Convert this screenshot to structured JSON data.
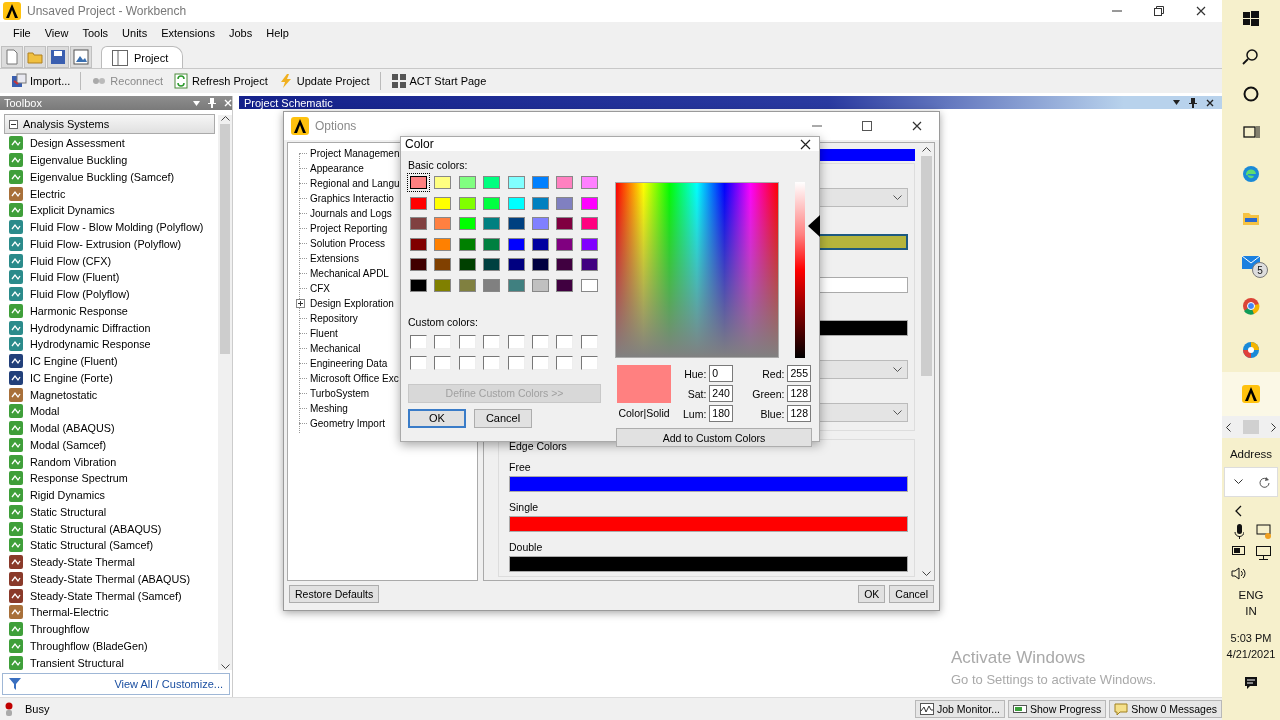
{
  "window": {
    "title": "Unsaved Project - Workbench"
  },
  "menu": [
    "File",
    "View",
    "Tools",
    "Units",
    "Extensions",
    "Jobs",
    "Help"
  ],
  "tabs": [
    {
      "label": "Project",
      "selected": true
    }
  ],
  "toolbar": [
    {
      "kind": "import",
      "label": "Import...",
      "disabled": false
    },
    {
      "kind": "reconnect",
      "label": "Reconnect",
      "disabled": true
    },
    {
      "kind": "refresh",
      "label": "Refresh Project",
      "disabled": false
    },
    {
      "kind": "update",
      "label": "Update Project",
      "disabled": false
    },
    {
      "kind": "act",
      "label": "ACT Start Page",
      "disabled": false
    }
  ],
  "toolbox": {
    "title": "Toolbox",
    "group": {
      "label": "Analysis Systems",
      "expanded": true
    },
    "items": [
      {
        "label": "Design Assessment",
        "color": "#3f9f3a"
      },
      {
        "label": "Eigenvalue Buckling",
        "color": "#3f9f3a"
      },
      {
        "label": "Eigenvalue Buckling (Samcef)",
        "color": "#3f9f3a"
      },
      {
        "label": "Electric",
        "color": "#a8703a"
      },
      {
        "label": "Explicit Dynamics",
        "color": "#3f9f3a"
      },
      {
        "label": "Fluid Flow - Blow Molding (Polyflow)",
        "color": "#2b8b8b"
      },
      {
        "label": "Fluid Flow- Extrusion (Polyflow)",
        "color": "#2b8b8b"
      },
      {
        "label": "Fluid Flow (CFX)",
        "color": "#2b8b8b"
      },
      {
        "label": "Fluid Flow (Fluent)",
        "color": "#2b8b8b"
      },
      {
        "label": "Fluid Flow (Polyflow)",
        "color": "#2b8b8b"
      },
      {
        "label": "Harmonic Response",
        "color": "#3f9f3a"
      },
      {
        "label": "Hydrodynamic Diffraction",
        "color": "#2b8b8b"
      },
      {
        "label": "Hydrodynamic Response",
        "color": "#2b8b8b"
      },
      {
        "label": "IC Engine (Fluent)",
        "color": "#22407a"
      },
      {
        "label": "IC Engine (Forte)",
        "color": "#22407a"
      },
      {
        "label": "Magnetostatic",
        "color": "#a8703a"
      },
      {
        "label": "Modal",
        "color": "#3f9f3a"
      },
      {
        "label": "Modal (ABAQUS)",
        "color": "#3f9f3a"
      },
      {
        "label": "Modal (Samcef)",
        "color": "#3f9f3a"
      },
      {
        "label": "Random Vibration",
        "color": "#3f9f3a"
      },
      {
        "label": "Response Spectrum",
        "color": "#3f9f3a"
      },
      {
        "label": "Rigid Dynamics",
        "color": "#3f9f3a"
      },
      {
        "label": "Static Structural",
        "color": "#3f9f3a"
      },
      {
        "label": "Static Structural (ABAQUS)",
        "color": "#3f9f3a"
      },
      {
        "label": "Static Structural (Samcef)",
        "color": "#3f9f3a"
      },
      {
        "label": "Steady-State Thermal",
        "color": "#8a3a2a"
      },
      {
        "label": "Steady-State Thermal (ABAQUS)",
        "color": "#8a3a2a"
      },
      {
        "label": "Steady-State Thermal (Samcef)",
        "color": "#8a3a2a"
      },
      {
        "label": "Thermal-Electric",
        "color": "#a8703a"
      },
      {
        "label": "Throughflow",
        "color": "#3f9f3a"
      },
      {
        "label": "Throughflow (BladeGen)",
        "color": "#3f9f3a"
      },
      {
        "label": "Transient Structural",
        "color": "#3f9f3a"
      }
    ],
    "footer": "View All / Customize..."
  },
  "schematic": {
    "title": "Project Schematic"
  },
  "options": {
    "title": "Options",
    "tree": [
      {
        "kind": "leaf",
        "label": "Project Managemen"
      },
      {
        "kind": "leaf",
        "label": "Appearance"
      },
      {
        "kind": "leaf",
        "label": "Regional and Langu"
      },
      {
        "kind": "leaf",
        "label": "Graphics Interactio"
      },
      {
        "kind": "leaf",
        "label": "Journals and Logs"
      },
      {
        "kind": "leaf",
        "label": "Project Reporting"
      },
      {
        "kind": "leaf",
        "label": "Solution Process"
      },
      {
        "kind": "leaf",
        "label": "Extensions"
      },
      {
        "kind": "leaf",
        "label": "Mechanical APDL"
      },
      {
        "kind": "leaf",
        "label": "CFX"
      },
      {
        "kind": "folder",
        "label": "Design Exploration"
      },
      {
        "kind": "leaf",
        "label": "Repository"
      },
      {
        "kind": "leaf",
        "label": "Fluent"
      },
      {
        "kind": "leaf",
        "label": "Mechanical"
      },
      {
        "kind": "leaf",
        "label": "Engineering Data"
      },
      {
        "kind": "leaf",
        "label": "Microsoft Office Exc"
      },
      {
        "kind": "leaf",
        "label": "TurboSystem"
      },
      {
        "kind": "leaf",
        "label": "Meshing"
      },
      {
        "kind": "leaf",
        "label": "Geometry Import"
      }
    ],
    "top_field": {
      "color": "#0000ff"
    },
    "fields": [
      {
        "kind": "dropdown"
      },
      {
        "kind": "color",
        "color": "#b5b53c",
        "selected": true
      },
      {
        "kind": "color",
        "color": "#ffffff",
        "selected": false
      },
      {
        "kind": "color",
        "color": "#000000",
        "selected": false
      },
      {
        "kind": "dropdown"
      },
      {
        "kind": "dropdown"
      }
    ],
    "edge_colors": {
      "title": "Edge Colors",
      "items": [
        {
          "label": "Free",
          "color": "#0000ff"
        },
        {
          "label": "Single",
          "color": "#ff0000"
        },
        {
          "label": "Double",
          "color": "#000000"
        }
      ]
    },
    "restore": "Restore Defaults",
    "ok": "OK",
    "cancel": "Cancel"
  },
  "color_dialog": {
    "title": "Color",
    "basic_label": "Basic colors:",
    "basic": [
      {
        "color": "#ff8080",
        "selected": true
      },
      {
        "color": "#ffff80",
        "selected": false
      },
      {
        "color": "#80ff80",
        "selected": false
      },
      {
        "color": "#00ff80",
        "selected": false
      },
      {
        "color": "#80ffff",
        "selected": false
      },
      {
        "color": "#0080ff",
        "selected": false
      },
      {
        "color": "#ff80c0",
        "selected": false
      },
      {
        "color": "#ff80ff",
        "selected": false
      },
      {
        "color": "#ff0000",
        "selected": false
      },
      {
        "color": "#ffff00",
        "selected": false
      },
      {
        "color": "#80ff00",
        "selected": false
      },
      {
        "color": "#00ff40",
        "selected": false
      },
      {
        "color": "#00ffff",
        "selected": false
      },
      {
        "color": "#0080c0",
        "selected": false
      },
      {
        "color": "#8080c0",
        "selected": false
      },
      {
        "color": "#ff00ff",
        "selected": false
      },
      {
        "color": "#804040",
        "selected": false
      },
      {
        "color": "#ff8040",
        "selected": false
      },
      {
        "color": "#00ff00",
        "selected": false
      },
      {
        "color": "#008080",
        "selected": false
      },
      {
        "color": "#004080",
        "selected": false
      },
      {
        "color": "#8080ff",
        "selected": false
      },
      {
        "color": "#800040",
        "selected": false
      },
      {
        "color": "#ff0080",
        "selected": false
      },
      {
        "color": "#800000",
        "selected": false
      },
      {
        "color": "#ff8000",
        "selected": false
      },
      {
        "color": "#008000",
        "selected": false
      },
      {
        "color": "#008040",
        "selected": false
      },
      {
        "color": "#0000ff",
        "selected": false
      },
      {
        "color": "#0000a0",
        "selected": false
      },
      {
        "color": "#800080",
        "selected": false
      },
      {
        "color": "#8000ff",
        "selected": false
      },
      {
        "color": "#400000",
        "selected": false
      },
      {
        "color": "#804000",
        "selected": false
      },
      {
        "color": "#004000",
        "selected": false
      },
      {
        "color": "#004040",
        "selected": false
      },
      {
        "color": "#000080",
        "selected": false
      },
      {
        "color": "#000040",
        "selected": false
      },
      {
        "color": "#400040",
        "selected": false
      },
      {
        "color": "#400080",
        "selected": false
      },
      {
        "color": "#000000",
        "selected": false
      },
      {
        "color": "#808000",
        "selected": false
      },
      {
        "color": "#808040",
        "selected": false
      },
      {
        "color": "#808080",
        "selected": false
      },
      {
        "color": "#408080",
        "selected": false
      },
      {
        "color": "#c0c0c0",
        "selected": false
      },
      {
        "color": "#400040",
        "selected": false
      },
      {
        "color": "#ffffff",
        "selected": false
      }
    ],
    "custom_label": "Custom colors:",
    "custom": [
      {
        "color": "#ffffff"
      },
      {
        "color": "#ffffff"
      },
      {
        "color": "#ffffff"
      },
      {
        "color": "#ffffff"
      },
      {
        "color": "#ffffff"
      },
      {
        "color": "#ffffff"
      },
      {
        "color": "#ffffff"
      },
      {
        "color": "#ffffff"
      },
      {
        "color": "#ffffff"
      },
      {
        "color": "#ffffff"
      },
      {
        "color": "#ffffff"
      },
      {
        "color": "#ffffff"
      },
      {
        "color": "#ffffff"
      },
      {
        "color": "#ffffff"
      },
      {
        "color": "#ffffff"
      },
      {
        "color": "#ffffff"
      }
    ],
    "define": {
      "label": "Define Custom Colors >>",
      "disabled": true
    },
    "ok": "OK",
    "cancel": "Cancel",
    "luminance": {
      "level": 0.75
    },
    "preview": {
      "color": "#ff8080",
      "label": "Color|Solid"
    },
    "fields": [
      {
        "label": "Hue:",
        "value": "0"
      },
      {
        "label": "Sat:",
        "value": "240"
      },
      {
        "label": "Lum:",
        "value": "180"
      },
      {
        "label": "Red:",
        "value": "255"
      },
      {
        "label": "Green:",
        "value": "128"
      },
      {
        "label": "Blue:",
        "value": "128"
      }
    ],
    "add": "Add to Custom Colors"
  },
  "status": {
    "text": "Busy",
    "buttons": [
      {
        "kind": "monitor",
        "label": "Job Monitor..."
      },
      {
        "kind": "progress",
        "label": "Show Progress"
      },
      {
        "kind": "messages",
        "label": "Show 0 Messages"
      }
    ]
  },
  "watermark": {
    "title": "Activate Windows",
    "subtitle": "Go to Settings to activate Windows."
  },
  "taskbar": {
    "mail_badge": "5",
    "address": "Address",
    "language": "ENG",
    "region": "IN",
    "time": "5:03 PM",
    "date": "4/21/2021"
  }
}
